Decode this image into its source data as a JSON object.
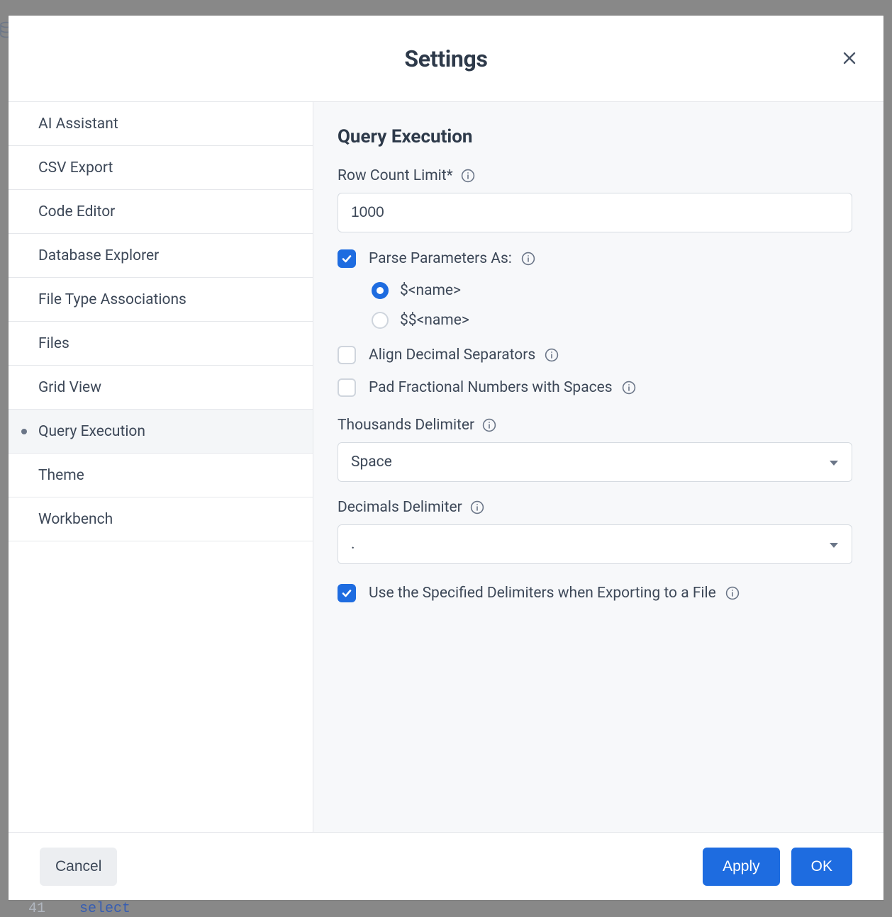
{
  "header": {
    "title": "Settings"
  },
  "sidebar": {
    "items": [
      {
        "label": "AI Assistant"
      },
      {
        "label": "CSV Export"
      },
      {
        "label": "Code Editor"
      },
      {
        "label": "Database Explorer"
      },
      {
        "label": "File Type Associations"
      },
      {
        "label": "Files"
      },
      {
        "label": "Grid View"
      },
      {
        "label": "Query Execution"
      },
      {
        "label": "Theme"
      },
      {
        "label": "Workbench"
      }
    ],
    "active_index": 7
  },
  "content": {
    "section_title": "Query Execution",
    "row_count": {
      "label": "Row Count Limit*",
      "value": "1000"
    },
    "parse_params": {
      "label": "Parse Parameters As:",
      "checked": true,
      "options": [
        {
          "label": "$<name>",
          "selected": true
        },
        {
          "label": "$$<name>",
          "selected": false
        }
      ]
    },
    "align_decimal": {
      "label": "Align Decimal Separators",
      "checked": false
    },
    "pad_fractional": {
      "label": "Pad Fractional Numbers with Spaces",
      "checked": false
    },
    "thousands": {
      "label": "Thousands Delimiter",
      "value": "Space"
    },
    "decimals": {
      "label": "Decimals Delimiter",
      "value": "."
    },
    "use_delimiters_export": {
      "label": "Use the Specified Delimiters when Exporting to a File",
      "checked": true
    }
  },
  "footer": {
    "cancel": "Cancel",
    "apply": "Apply",
    "ok": "OK"
  },
  "background": {
    "line_num": "41",
    "keyword": "select"
  }
}
